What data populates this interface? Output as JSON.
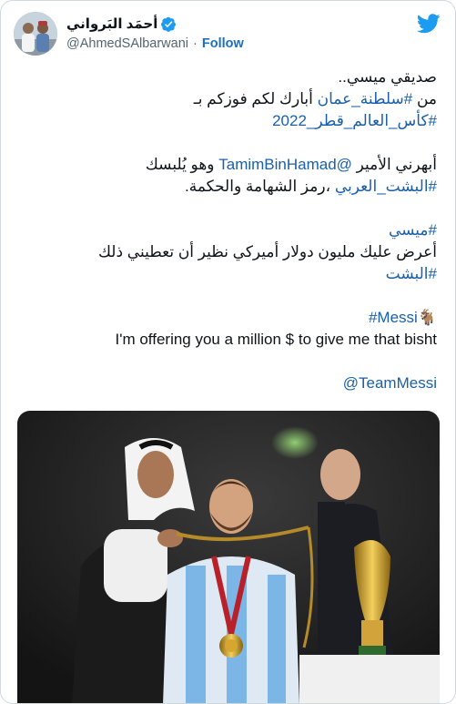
{
  "tweet": {
    "display_name": "أحمَد البَرواني",
    "handle": "@AhmedSAlbarwani",
    "separator": "·",
    "follow_label": "Follow",
    "paragraph1": {
      "line1": "صديقي ميسي..",
      "line2_pre": "من ",
      "line2_tag": "#سلطنة_عمان",
      "line2_post": " أبارك لكم فوزكم بـ",
      "line3_tag": "#كأس_العالم_قطر_2022"
    },
    "paragraph2": {
      "line1_pre": "أبهرني الأمير ",
      "line1_mention": "@TamimBinHamad",
      "line1_post": " وهو يُلبسك",
      "line2_tag": "#البشت_العربي",
      "line2_post": " ،رمز الشهامة والحكمة."
    },
    "paragraph3": {
      "line1_tag": "#ميسي",
      "line2": "أعرض عليك مليون دولار أميركي نظير أن تعطيني ذلك",
      "line3_tag": "#البشت"
    },
    "paragraph4": {
      "tag": "#Messi",
      "emoji": "🐐",
      "line2": "I'm offering you a million $ to give me that bisht"
    },
    "mention_line": "@TeamMessi"
  },
  "colors": {
    "link": "#1b5fa8",
    "follow": "#1d6fc0",
    "twitter_blue": "#1d9bf0",
    "verified_blue": "#1d9bf0"
  },
  "icons": {
    "verified": "verified-badge-icon",
    "logo": "twitter-bird-icon"
  }
}
